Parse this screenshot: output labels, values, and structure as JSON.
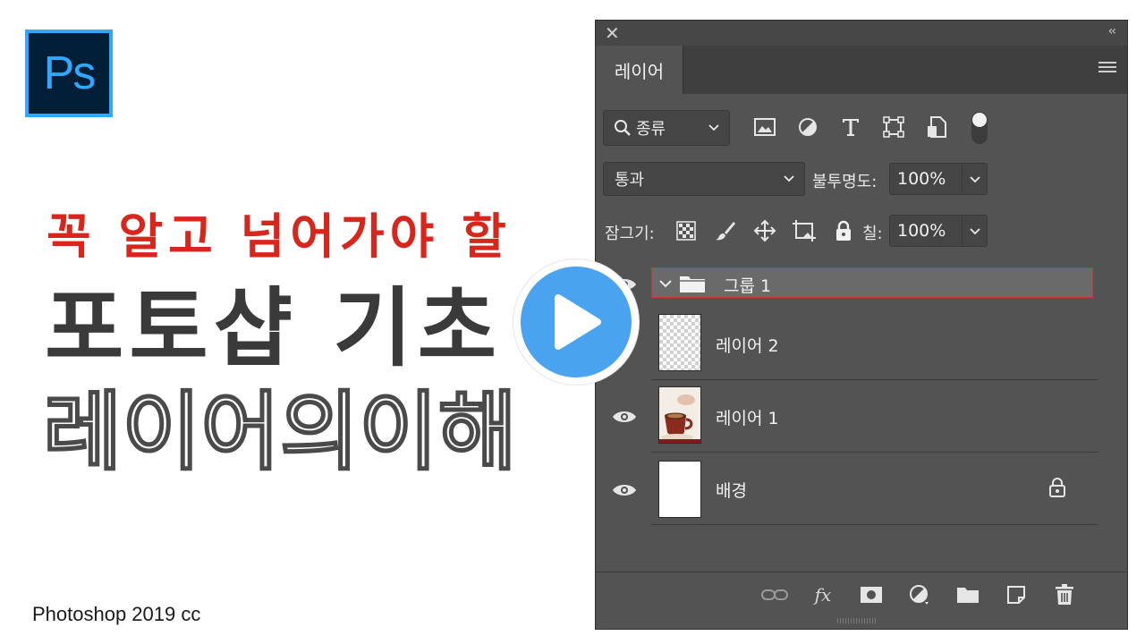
{
  "thumbnail": {
    "logo_text": "Ps",
    "headline_red": "꼭 알고 넘어가야 할",
    "headline_dark": "포토샵 기초",
    "headline_outline": "레이어의이해",
    "version": "Photoshop 2019 cc",
    "colors": {
      "red": "#d9261c",
      "play": "#4aa3ee",
      "ps_blue": "#31a8ff"
    }
  },
  "panel": {
    "tab_label": "레이어",
    "filter": {
      "label": "종류"
    },
    "blend_mode": "통과",
    "opacity_label": "불투명도:",
    "opacity_value": "100%",
    "lock_label": "잠그기:",
    "fill_label": "칠:",
    "fill_value": "100%",
    "layers": [
      {
        "name": "그룹 1",
        "type": "group",
        "visible": true,
        "selected": true
      },
      {
        "name": "레이어 2",
        "type": "transparent",
        "visible": false
      },
      {
        "name": "레이어 1",
        "type": "photo",
        "visible": true
      },
      {
        "name": "배경",
        "type": "background",
        "visible": true,
        "locked": true
      }
    ],
    "footer_fx": "fx"
  }
}
